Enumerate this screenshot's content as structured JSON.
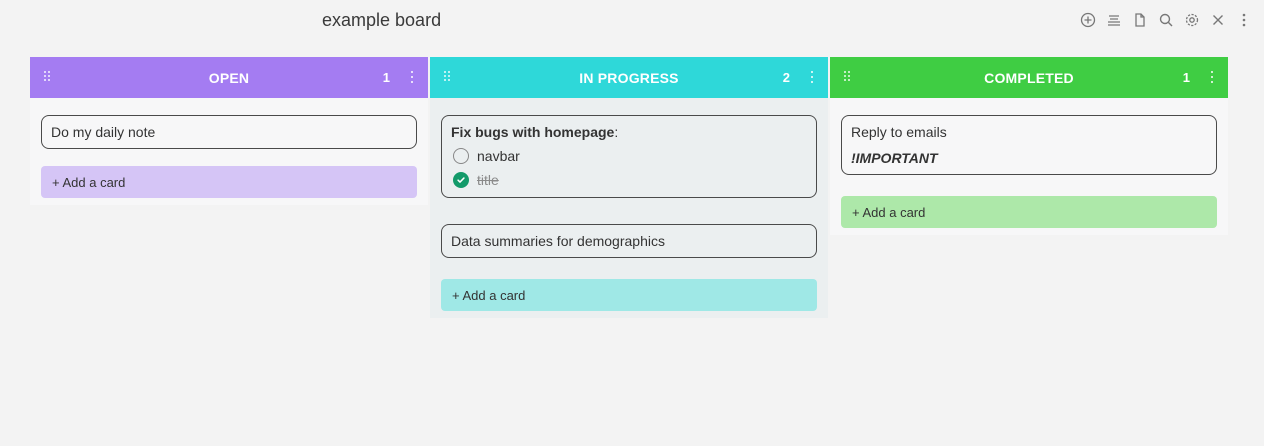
{
  "board": {
    "title": "example board"
  },
  "toolbar": {
    "icons": [
      "add-icon",
      "list-view-icon",
      "file-icon",
      "search-icon",
      "settings-icon",
      "close-icon",
      "more-icon"
    ]
  },
  "lanes": [
    {
      "title": "OPEN",
      "count": "1",
      "color": "#a47cf2",
      "add_color": "#d5c5f6",
      "body_bg": "#f7f7f8",
      "add_label": "+ Add a card",
      "cards": [
        {
          "text": "Do my daily note"
        }
      ]
    },
    {
      "title": "IN PROGRESS",
      "count": "2",
      "color": "#2ed8d9",
      "add_color": "#9fe8e6",
      "body_bg": "#ebeff0",
      "add_label": "+ Add a card",
      "cards": [
        {
          "title": "Fix bugs with homepage",
          "suffix": ":",
          "tasks": [
            {
              "label": "navbar",
              "done": false
            },
            {
              "label": "title",
              "done": true
            }
          ]
        },
        {
          "text": "Data summaries for demographics"
        }
      ]
    },
    {
      "title": "COMPLETED",
      "count": "1",
      "color": "#3fcd43",
      "add_color": "#ade8a9",
      "body_bg": "#f7f7f8",
      "add_label": "+ Add a card",
      "cards": [
        {
          "text": "Reply to emails",
          "note": "!IMPORTANT"
        }
      ]
    }
  ]
}
